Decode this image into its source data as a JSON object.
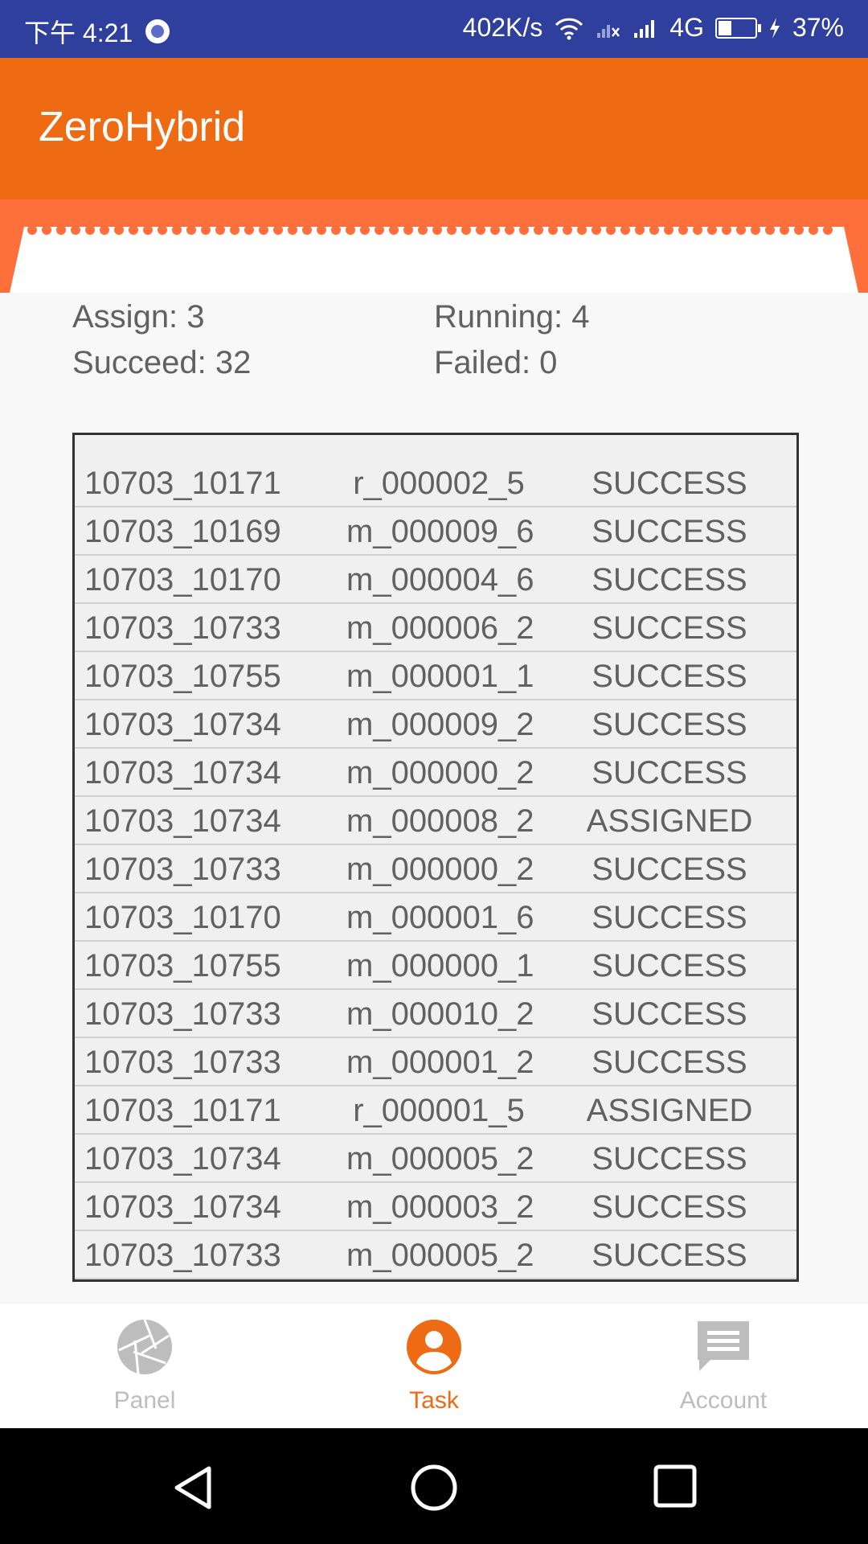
{
  "status_bar": {
    "time": "下午 4:21",
    "net_speed": "402K/s",
    "network": "4G",
    "battery_text": "37%",
    "battery_level": 0.37
  },
  "app_bar": {
    "title": "ZeroHybrid"
  },
  "stats": {
    "assign": "Assign: 3",
    "running": "Running: 4",
    "succeed": "Succeed: 32",
    "failed": "Failed: 0"
  },
  "tasks": [
    {
      "id": "10703_10171",
      "task": "r_000002_5",
      "status": "SUCCESS"
    },
    {
      "id": "10703_10169",
      "task": "m_000009_6",
      "status": "SUCCESS"
    },
    {
      "id": "10703_10170",
      "task": "m_000004_6",
      "status": "SUCCESS"
    },
    {
      "id": "10703_10733",
      "task": "m_000006_2",
      "status": "SUCCESS"
    },
    {
      "id": "10703_10755",
      "task": "m_000001_1",
      "status": "SUCCESS"
    },
    {
      "id": "10703_10734",
      "task": "m_000009_2",
      "status": "SUCCESS"
    },
    {
      "id": "10703_10734",
      "task": "m_000000_2",
      "status": "SUCCESS"
    },
    {
      "id": "10703_10734",
      "task": "m_000008_2",
      "status": "ASSIGNED"
    },
    {
      "id": "10703_10733",
      "task": "m_000000_2",
      "status": "SUCCESS"
    },
    {
      "id": "10703_10170",
      "task": "m_000001_6",
      "status": "SUCCESS"
    },
    {
      "id": "10703_10755",
      "task": "m_000000_1",
      "status": "SUCCESS"
    },
    {
      "id": "10703_10733",
      "task": "m_000010_2",
      "status": "SUCCESS"
    },
    {
      "id": "10703_10733",
      "task": "m_000001_2",
      "status": "SUCCESS"
    },
    {
      "id": "10703_10171",
      "task": "r_000001_5",
      "status": "ASSIGNED"
    },
    {
      "id": "10703_10734",
      "task": "m_000005_2",
      "status": "SUCCESS"
    },
    {
      "id": "10703_10734",
      "task": "m_000003_2",
      "status": "SUCCESS"
    },
    {
      "id": "10703_10733",
      "task": "m_000005_2",
      "status": "SUCCESS"
    }
  ],
  "bottom_nav": {
    "items": [
      {
        "label": "Panel",
        "icon": "aperture-icon",
        "active": false
      },
      {
        "label": "Task",
        "icon": "person-icon",
        "active": true
      },
      {
        "label": "Account",
        "icon": "chat-icon",
        "active": false
      }
    ]
  },
  "colors": {
    "status_bar": "#2e3f9e",
    "accent": "#ee6b14",
    "nav_inactive": "#bdbdbd"
  }
}
